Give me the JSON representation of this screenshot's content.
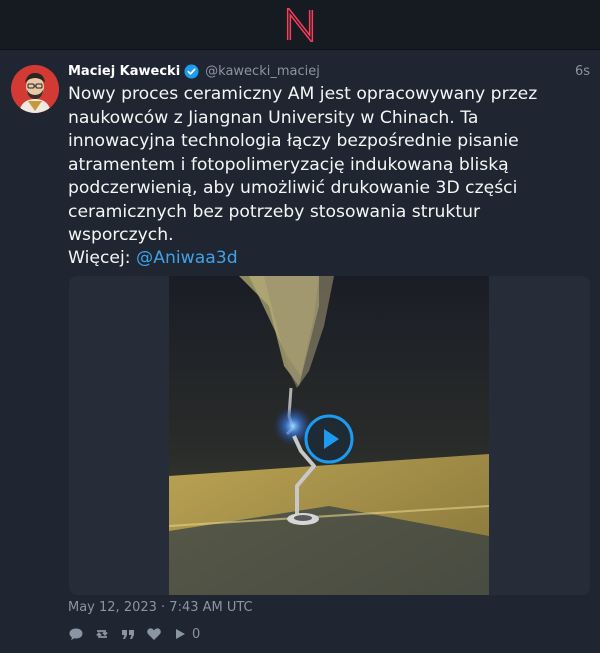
{
  "app": {
    "logo_icon": "nitter-n-logo",
    "accent": "#ff3b5c"
  },
  "tweet": {
    "author": {
      "fullname": "Maciej Kawecki",
      "username": "@kawecki_maciej",
      "verified": true
    },
    "time": "6s",
    "text": "Nowy proces ceramiczny AM jest opracowywany przez naukowców z Jiangnan University w Chinach. Ta innowacyjna technologia łączy bezpośrednie pisanie atramentem i fotopolimeryzację indukowaną bliską podczerwienią, aby umożliwić drukowanie 3D części ceramicznych bez potrzeby stosowania struktur wsporczych.",
    "more_label": "Więcej: ",
    "more_link": "@Aniwaa3d",
    "date": "May 12, 2023 · 7:43 AM UTC",
    "media": {
      "type": "video",
      "icon": "play-icon"
    },
    "stats": {
      "reply_icon": "comment-icon",
      "retweet_icon": "retweet-icon",
      "quote_icon": "quote-icon",
      "like_icon": "heart-icon",
      "views_icon": "play-count-icon",
      "views": "0"
    }
  }
}
